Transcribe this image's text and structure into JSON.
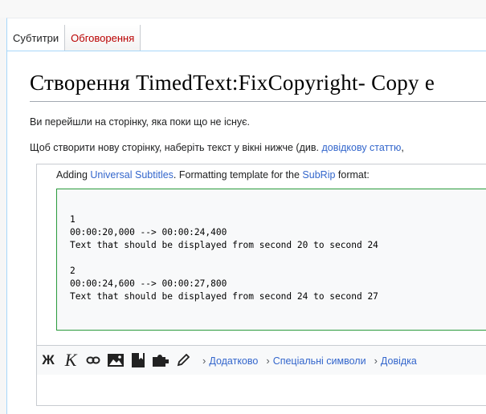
{
  "tabs": [
    {
      "label": "Субтитри",
      "active": true
    },
    {
      "label": "Обговорення",
      "active": false,
      "color": "#ba0000"
    }
  ],
  "title": "Створення TimedText:FixCopyright- Copy e",
  "notice": "Ви перейшли на сторінку, яка поки що не існує.",
  "instruction": {
    "prefix": "Щоб створити нову сторінку, наберіть текст у вікні нижче (див. ",
    "link": "довідкову статтю",
    "suffix": ","
  },
  "editor": {
    "adding_prefix": "Adding ",
    "adding_link1": "Universal Subtitles",
    "adding_mid": ". Formatting template for the ",
    "adding_link2": "SubRip",
    "adding_suffix": " format:",
    "srt_text": "1\n00:00:20,000 --> 00:00:24,400\nText that should be displayed from second 20 to second 24\n\n2\n00:00:24,600 --> 00:00:27,800\nText that should be displayed from second 24 to second 27"
  },
  "toolbar": {
    "bold_label": "Ж",
    "italic_label": "К",
    "icons": [
      "link-icon",
      "image-icon",
      "bookmark-icon",
      "puzzle-icon",
      "pencil-icon"
    ],
    "menus": [
      "Додатково",
      "Спеціальні символи",
      "Довідка"
    ],
    "chevron": "›"
  },
  "colors": {
    "link": "#3366cc",
    "redlink": "#ba0000",
    "srt_border": "#2a9a3c"
  }
}
